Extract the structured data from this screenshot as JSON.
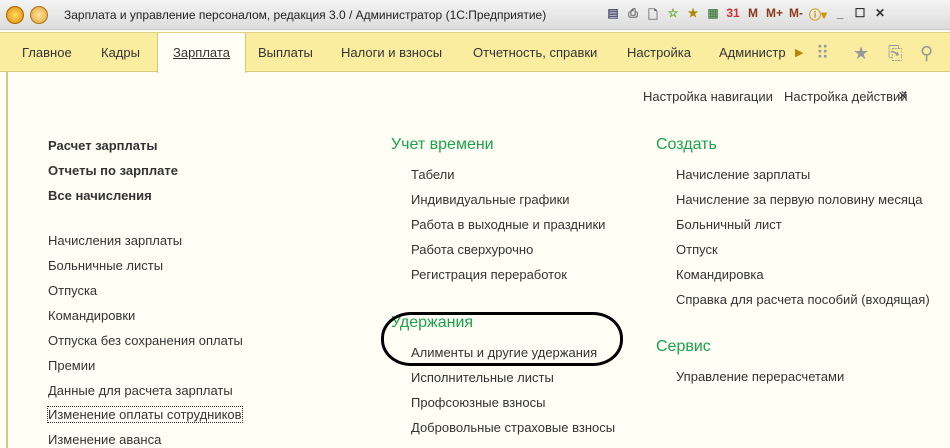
{
  "window": {
    "title": "Зарплата и управление персоналом, редакция 3.0 / Администратор  (1С:Предприятие)",
    "tools": [
      "M",
      "M+",
      "M-"
    ]
  },
  "nav": {
    "tabs": [
      "Главное",
      "Кадры",
      "Зарплата",
      "Выплаты",
      "Налоги и взносы",
      "Отчетность, справки",
      "Настройка",
      "Администр"
    ],
    "active": "Зарплата"
  },
  "top_links": {
    "nav_settings": "Настройка навигации",
    "action_settings": "Настройка действий",
    "close": "×"
  },
  "left": {
    "bold_items": [
      "Расчет зарплаты",
      "Отчеты по зарплате",
      "Все начисления"
    ],
    "items": [
      "Начисления зарплаты",
      "Больничные листы",
      "Отпуска",
      "Командировки",
      "Отпуска без сохранения оплаты",
      "Премии",
      "Данные для расчета зарплаты",
      "Изменение оплаты сотрудников",
      "Изменение аванса"
    ]
  },
  "middle": {
    "time_header": "Учет времени",
    "time_items": [
      "Табели",
      "Индивидуальные графики",
      "Работа в выходные и праздники",
      "Работа сверхурочно",
      "Регистрация переработок"
    ],
    "deduct_header": "Удержания",
    "deduct_items": [
      "Алименты и другие удержания",
      "Исполнительные листы",
      "Профсоюзные взносы",
      "Добровольные страховые взносы"
    ]
  },
  "right": {
    "create_header": "Создать",
    "create_items": [
      "Начисление зарплаты",
      "Начисление за первую половину месяца",
      "Больничный лист",
      "Отпуск",
      "Командировка",
      "Справка для расчета пособий (входящая)"
    ],
    "service_header": "Сервис",
    "service_items": [
      "Управление перерасчетами"
    ]
  }
}
